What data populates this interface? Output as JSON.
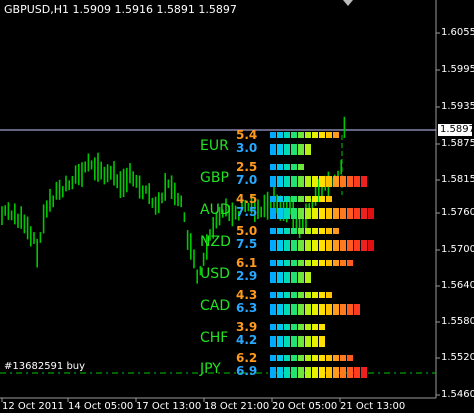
{
  "window": {
    "title": "GBPUSD,H1  1.5909 1.5916 1.5891 1.5897"
  },
  "price_axis": {
    "labels": [
      "1.6055",
      "1.5995",
      "1.5935",
      "1.5875",
      "1.5815",
      "1.5760",
      "1.5700",
      "1.5640",
      "1.5580",
      "1.5520",
      "1.5460"
    ],
    "current_price": "1.5897"
  },
  "time_axis": {
    "labels": [
      "12 Oct 2011",
      "14 Oct 05:00",
      "17 Oct 13:00",
      "18 Oct 21:00",
      "20 Oct 05:00",
      "21 Oct 13:00"
    ]
  },
  "order_line": {
    "label": "#13682591 buy"
  },
  "currency_strength": [
    {
      "currency": "EUR",
      "v1": "5.4",
      "v2": "3.0",
      "bars1": 10,
      "bars2": 6
    },
    {
      "currency": "GBP",
      "v1": "2.5",
      "v2": "7.0",
      "bars1": 5,
      "bars2": 14
    },
    {
      "currency": "AUD",
      "v1": "4.5",
      "v2": "7.5",
      "bars1": 9,
      "bars2": 15
    },
    {
      "currency": "NZD",
      "v1": "5.0",
      "v2": "7.5",
      "bars1": 10,
      "bars2": 15
    },
    {
      "currency": "USD",
      "v1": "6.1",
      "v2": "2.9",
      "bars1": 12,
      "bars2": 6
    },
    {
      "currency": "CAD",
      "v1": "4.3",
      "v2": "6.3",
      "bars1": 9,
      "bars2": 13
    },
    {
      "currency": "CHF",
      "v1": "3.9",
      "v2": "4.2",
      "bars1": 8,
      "bars2": 8
    },
    {
      "currency": "JPY",
      "v1": "6.2",
      "v2": "6.9",
      "bars1": 12,
      "bars2": 14
    }
  ],
  "colors": {
    "background": "#000000",
    "candle": "#00c800",
    "grid": "#ffffff",
    "value_top": "#ff9a1f",
    "value_bottom": "#29a8ff",
    "currency_label": "#22e222"
  }
}
